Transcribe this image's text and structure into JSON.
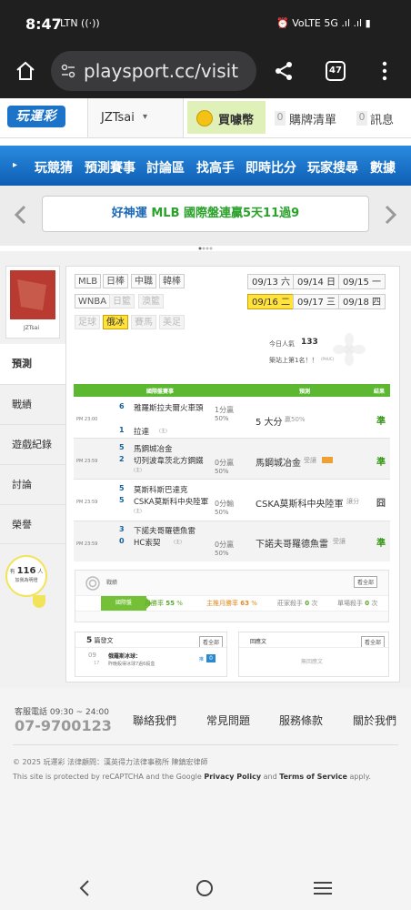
{
  "status": {
    "time": "8:47",
    "icons_left": "LTN ((·))",
    "icons_right": "⏰ VoLTE 5G .ıl .ıl ▮"
  },
  "browser": {
    "url": "playsport.cc/visit",
    "tab_count": "47"
  },
  "site": {
    "logo": "玩運彩",
    "user": "JZTsai",
    "buy": "買噱幣",
    "cart_count": "0",
    "cart": "購牌清單",
    "msg_count": "0",
    "msg": "訊息"
  },
  "nav": [
    "玩競猜",
    "預測賽事",
    "討論區",
    "找高手",
    "即時比分",
    "玩家搜尋",
    "數據"
  ],
  "banner": {
    "prefix": "好神運",
    "text": "MLB 國際盤連贏5天11過9"
  },
  "profile": {
    "name": "JZTsai"
  },
  "leagues": {
    "row1": [
      "MLB",
      "日棒",
      "中職",
      "韓棒"
    ],
    "row2": [
      "WNBA",
      "日籃",
      "澳籃"
    ],
    "row3": [
      "足球",
      "俄冰",
      "賽馬",
      "美足"
    ]
  },
  "dates": {
    "row1": [
      "09/13 六",
      "09/14 日",
      "09/15 一"
    ],
    "row2": [
      "09/16 二",
      "09/17 三",
      "09/18 四"
    ]
  },
  "popularity": {
    "label": "今日人氣",
    "value": "133",
    "rank": "築站上第1名！！",
    "rank_note": "(PHUC)"
  },
  "sidebar": [
    "預測",
    "戰績",
    "遊戲紀錄",
    "討論",
    "榮譽"
  ],
  "fans": {
    "prefix": "有",
    "count": "116",
    "suffix": "人",
    "label": "加我為明燈"
  },
  "table": {
    "headers": [
      "國際盤賽事",
      "預測",
      "結果"
    ],
    "rows": [
      {
        "time": "PM 23:00",
        "n1": "6",
        "t1": "雅羅斯拉夫爾火車頭",
        "n2": "1",
        "t2": "拉達",
        "mark2": "(主)",
        "line": "1分贏",
        "pct": "50%",
        "pick": "5 大分",
        "pick_note": "贏50%",
        "result": "準"
      },
      {
        "time": "PM 23:59",
        "n1": "5",
        "t1": "馬鋼城冶金",
        "n2": "2",
        "t2": "切列波韋茨北方鋼鐵",
        "mark2": "(主)",
        "line": "0分贏",
        "pct": "50%",
        "pick": "馬鋼城冶金",
        "pick_note": "受讓",
        "result": "準"
      },
      {
        "time": "PM 23:59",
        "n1": "5",
        "t1": "莫斯科斯巴達克",
        "n2": "5",
        "t2": "CSKA莫斯科中央陸軍",
        "mark2": "(主)",
        "line": "0分輸",
        "pct": "50%",
        "pick": "CSKA莫斯科中央陸軍",
        "pick_note": "讓分",
        "result": "囧"
      },
      {
        "time": "PM 23:59",
        "n1": "3",
        "t1": "下諾夫哥羅德魚雷",
        "n2": "0",
        "t2": "HC索契",
        "mark2": "(主)",
        "line": "0分贏",
        "pct": "50%",
        "pick": "下諾夫哥羅德魚雷",
        "pick_note": "受讓",
        "result": "準"
      }
    ]
  },
  "record": {
    "title": "戰績",
    "more": "看全部",
    "tag": "國際盤",
    "month_label": "月勝率",
    "month_val": "55",
    "home_label": "主推月勝率",
    "home_val": "63",
    "kill_label": "莊家殺手",
    "kill_val": "0",
    "kill_unit": "次",
    "single_label": "單場殺手",
    "single_val": "0",
    "single_unit": "次"
  },
  "posts": {
    "count": "5",
    "title": "篇發文",
    "more": "看全部",
    "date_m": "09",
    "date_d": "17",
    "post_title": "俄羅斯冰球：",
    "post_sub": "昨晚殺得冰球7過6殺盒",
    "replies": "0",
    "reply_prefix": "推"
  },
  "replies": {
    "title": "回應文",
    "more": "看全部",
    "empty": "無回應文"
  },
  "footer": {
    "phone_label": "客服電話 09:30 ~ 24:00",
    "phone": "07-9700123",
    "links": [
      "聯絡我們",
      "常見問題",
      "服務條款",
      "關於我們"
    ],
    "copyright": "© 2025 玩運彩 法律顧問：漢英得力法律事務所 陳鎮宏律師",
    "recaptcha_pre": "This site is protected by reCAPTCHA and the Google ",
    "privacy": "Privacy Policy",
    "and": " and ",
    "terms": "Terms of Service",
    "apply": " apply."
  }
}
